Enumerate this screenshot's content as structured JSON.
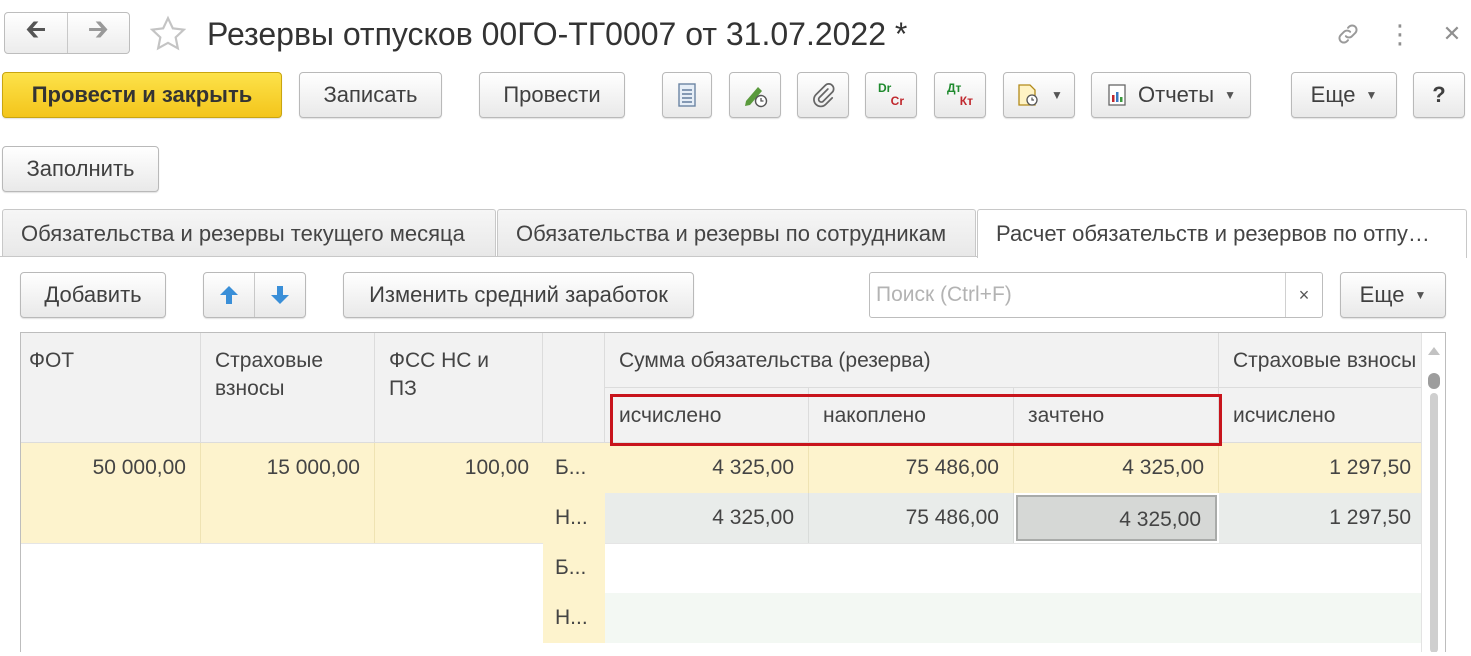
{
  "window": {
    "title": "Резервы отпусков 00ГО-ТГ0007 от 31.07.2022 *"
  },
  "toolbar": {
    "post_close": "Провести и закрыть",
    "save": "Записать",
    "post": "Провести",
    "dr_cr": "Dr/Cr",
    "dt_kt": "Дт/Кт",
    "reports": "Отчеты",
    "more": "Еще",
    "help": "?"
  },
  "fill_button": "Заполнить",
  "tabs": [
    {
      "label": "Обязательства и резервы текущего месяца"
    },
    {
      "label": "Обязательства и резервы по сотрудникам"
    },
    {
      "label": "Расчет обязательств и резервов по отпу…"
    }
  ],
  "table_toolbar": {
    "add": "Добавить",
    "change_avg": "Изменить средний заработок",
    "search_placeholder": "Поиск (Ctrl+F)",
    "clear": "×",
    "more": "Еще"
  },
  "grid": {
    "headers": {
      "fot": "ФОТ",
      "ins": "Страховые взносы",
      "fss": "ФСС НС и ПЗ",
      "group_sum": "Сумма обязательства (резерва)",
      "calc": "исчислено",
      "accum": "накоплено",
      "credited": "зачтено",
      "group_ins": "Страховые взносы",
      "ins_calc": "исчислено"
    },
    "rows": [
      {
        "fot": "50 000,00",
        "ins": "15 000,00",
        "fss": "100,00",
        "sub": [
          {
            "type": "Б...",
            "calc": "4 325,00",
            "accum": "75 486,00",
            "credited": "4 325,00",
            "ins_calc": "1 297,50"
          },
          {
            "type": "Н...",
            "calc": "4 325,00",
            "accum": "75 486,00",
            "credited": "4 325,00",
            "ins_calc": "1 297,50"
          }
        ]
      },
      {
        "fot": "",
        "ins": "",
        "fss": "",
        "sub": [
          {
            "type": "Б...",
            "calc": "",
            "accum": "",
            "credited": "",
            "ins_calc": ""
          },
          {
            "type": "Н...",
            "calc": "",
            "accum": "",
            "credited": "",
            "ins_calc": ""
          }
        ]
      }
    ]
  },
  "colors": {
    "primary_yellow": "#f5c823",
    "row_yellow": "#fdf3cd",
    "row_gray": "#e9ecea",
    "row_green": "#f3f8f3",
    "highlight_red": "#c8141c"
  }
}
